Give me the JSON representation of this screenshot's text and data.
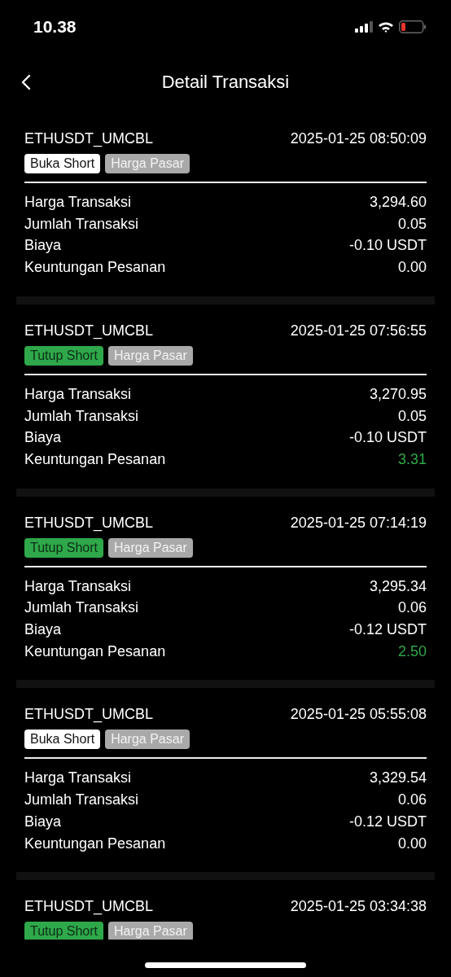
{
  "status_bar": {
    "time": "10.38"
  },
  "header": {
    "title": "Detail Transaksi"
  },
  "cards": [
    {
      "symbol": "ETHUSDT_UMCBL",
      "time": "2025-01-25 08:50:09",
      "tags": [
        {
          "label": "Buka Short",
          "kind": "open"
        },
        {
          "label": "Harga Pasar",
          "kind": "type"
        }
      ],
      "rows": [
        {
          "label": "Harga Transaksi",
          "value": "3,294.60",
          "highlight": false
        },
        {
          "label": "Jumlah Transaksi",
          "value": "0.05",
          "highlight": false
        },
        {
          "label": "Biaya",
          "value": "-0.10 USDT",
          "highlight": false
        },
        {
          "label": "Keuntungan Pesanan",
          "value": "0.00",
          "highlight": false
        }
      ]
    },
    {
      "symbol": "ETHUSDT_UMCBL",
      "time": "2025-01-25 07:56:55",
      "tags": [
        {
          "label": "Tutup Short",
          "kind": "close"
        },
        {
          "label": "Harga Pasar",
          "kind": "type"
        }
      ],
      "rows": [
        {
          "label": "Harga Transaksi",
          "value": "3,270.95",
          "highlight": false
        },
        {
          "label": "Jumlah Transaksi",
          "value": "0.05",
          "highlight": false
        },
        {
          "label": "Biaya",
          "value": "-0.10 USDT",
          "highlight": false
        },
        {
          "label": "Keuntungan Pesanan",
          "value": "3.31",
          "highlight": true
        }
      ]
    },
    {
      "symbol": "ETHUSDT_UMCBL",
      "time": "2025-01-25 07:14:19",
      "tags": [
        {
          "label": "Tutup Short",
          "kind": "close"
        },
        {
          "label": "Harga Pasar",
          "kind": "type"
        }
      ],
      "rows": [
        {
          "label": "Harga Transaksi",
          "value": "3,295.34",
          "highlight": false
        },
        {
          "label": "Jumlah Transaksi",
          "value": "0.06",
          "highlight": false
        },
        {
          "label": "Biaya",
          "value": "-0.12 USDT",
          "highlight": false
        },
        {
          "label": "Keuntungan Pesanan",
          "value": "2.50",
          "highlight": true
        }
      ]
    },
    {
      "symbol": "ETHUSDT_UMCBL",
      "time": "2025-01-25 05:55:08",
      "tags": [
        {
          "label": "Buka Short",
          "kind": "open"
        },
        {
          "label": "Harga Pasar",
          "kind": "type"
        }
      ],
      "rows": [
        {
          "label": "Harga Transaksi",
          "value": "3,329.54",
          "highlight": false
        },
        {
          "label": "Jumlah Transaksi",
          "value": "0.06",
          "highlight": false
        },
        {
          "label": "Biaya",
          "value": "-0.12 USDT",
          "highlight": false
        },
        {
          "label": "Keuntungan Pesanan",
          "value": "0.00",
          "highlight": false
        }
      ]
    },
    {
      "symbol": "ETHUSDT_UMCBL",
      "time": "2025-01-25 03:34:38",
      "tags": [
        {
          "label": "Tutup Short",
          "kind": "close"
        },
        {
          "label": "Harga Pasar",
          "kind": "type"
        }
      ]
    }
  ]
}
